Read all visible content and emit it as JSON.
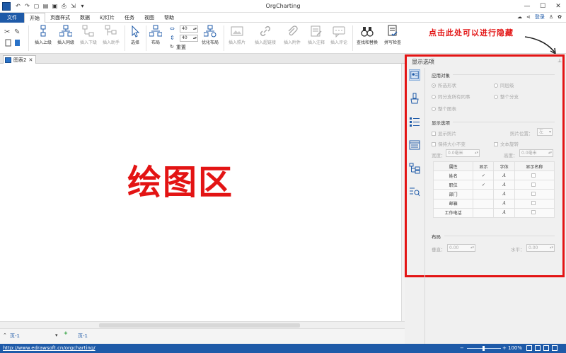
{
  "window": {
    "title": "OrgCharting"
  },
  "menu": {
    "file": "文件",
    "items": [
      "开始",
      "页面样式",
      "数据",
      "幻灯片",
      "任务",
      "视图",
      "帮助"
    ],
    "login": "登录"
  },
  "ribbon": {
    "insert_superior": "插入上级",
    "insert_peer": "插入同级",
    "insert_subordinate": "插入下级",
    "insert_assistant": "插入助手",
    "select": "选择",
    "layout": "布局",
    "spacing_h": "40",
    "spacing_v": "40",
    "reset": "重置",
    "optimize_layout": "优化布局",
    "insert_photo": "插入照片",
    "insert_hyperlink": "插入超链接",
    "insert_attachment": "插入附件",
    "insert_note": "插入注释",
    "insert_comment": "插入评论",
    "find_replace": "查找和替换",
    "spell_check": "拼写检查"
  },
  "doc_tab": {
    "name": "图表2"
  },
  "canvas": {
    "label": "绘图区"
  },
  "annotation": {
    "text": "点击此处可以进行隐藏"
  },
  "panel": {
    "title": "显示选项",
    "apply_to": {
      "heading": "应用对象",
      "selected_shape": "所选形状",
      "same_level": "同层级",
      "all_peers": "同分支所有同事",
      "whole_branch": "整个分支",
      "whole_chart": "整个图表"
    },
    "display": {
      "heading": "显示选项",
      "show_photo": "显示照片",
      "photo_position_label": "照片位置：",
      "photo_position_value": "左",
      "keep_size": "保持大小不变",
      "text_rotate": "文本旋转",
      "width_label": "宽度：",
      "width_value": "0.0毫米",
      "height_label": "高度：",
      "height_value": "0.0毫米"
    },
    "table": {
      "headers": [
        "属性",
        "显示",
        "字体",
        "显示名称"
      ],
      "rows": [
        {
          "name": "姓名",
          "shown": "✓"
        },
        {
          "name": "职位",
          "shown": "✓"
        },
        {
          "name": "部门",
          "shown": ""
        },
        {
          "name": "邮箱",
          "shown": ""
        },
        {
          "name": "工作电话",
          "shown": ""
        }
      ],
      "font_glyph": "A"
    },
    "layout": {
      "heading": "布局",
      "vertical_label": "垂直：",
      "vertical_value": "0.00",
      "horizontal_label": "水平：",
      "horizontal_value": "0.00"
    }
  },
  "pagebar": {
    "page_dropdown": "页-1",
    "page_tab": "页-1"
  },
  "status": {
    "url": "http://www.edrawsoft.cn/orgcharting/",
    "zoom": "100%"
  }
}
